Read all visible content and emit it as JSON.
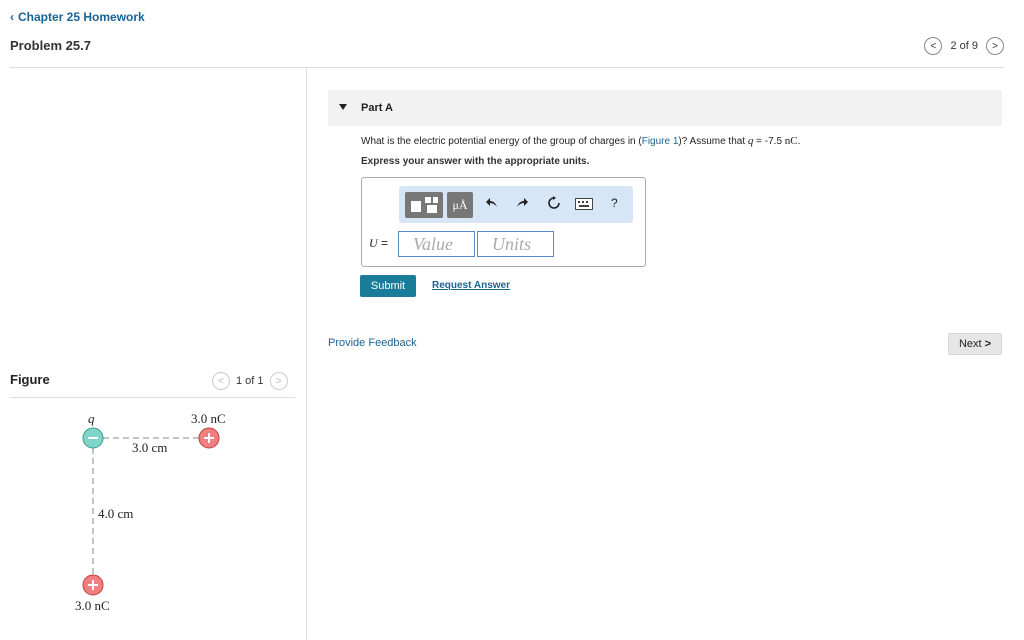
{
  "header": {
    "back_link": "Chapter 25 Homework",
    "problem_title": "Problem 25.7",
    "pager_text": "2 of 9"
  },
  "part": {
    "title": "Part A",
    "question_prefix": "What is the electric potential energy of the group of charges in (",
    "figure_link": "Figure 1",
    "question_middle": ")? Assume that ",
    "q_var": "q",
    "question_value": " = -7.5 ",
    "question_unit": "nC",
    "question_end": ".",
    "instruction": "Express your answer with the appropriate units."
  },
  "answer": {
    "label_var": "U",
    "label_eq": " =",
    "value_placeholder": "Value",
    "units_placeholder": "Units",
    "toolbar": {
      "units_btn": "μÅ",
      "help": "?"
    }
  },
  "actions": {
    "submit": "Submit",
    "request_answer": "Request Answer",
    "provide_feedback": "Provide Feedback",
    "next": "Next"
  },
  "figure": {
    "title": "Figure",
    "pager_text": "1 of 1",
    "labels": {
      "q": "q",
      "top_right_charge": "3.0 nC",
      "horizontal_distance": "3.0 cm",
      "vertical_distance": "4.0 cm",
      "bottom_charge": "3.0 nC"
    }
  },
  "colors": {
    "link": "#1a6496",
    "submit_bg": "#1a7c99",
    "negative_charge": "#7fd6c8",
    "positive_charge": "#f08080"
  }
}
